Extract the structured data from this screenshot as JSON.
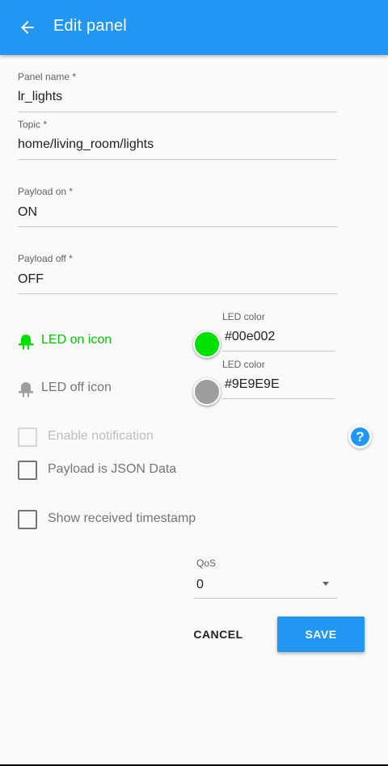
{
  "appbar": {
    "title": "Edit panel",
    "back_icon": "arrow-left-icon",
    "bg_color": "#2196f3"
  },
  "form": {
    "panel_name": {
      "label": "Panel name *",
      "value": "lr_lights"
    },
    "topic": {
      "label": "Topic *",
      "value": "home/living_room/lights"
    },
    "payload_on": {
      "label": "Payload on *",
      "value": "ON"
    },
    "payload_off": {
      "label": "Payload off *",
      "value": "OFF"
    },
    "led_on": {
      "label": "LED on icon",
      "icon": "led-bulb-icon",
      "color_label": "LED color",
      "color_value": "#00e002",
      "color": "#00e002"
    },
    "led_off": {
      "label": "LED off icon",
      "icon": "led-bulb-icon",
      "color_label": "LED color",
      "color_value": "#9E9E9E",
      "color": "#9E9E9E"
    },
    "enable_notification": {
      "label": "Enable notification",
      "checked": false,
      "disabled": true
    },
    "help_icon": "help-circle-icon",
    "payload_json": {
      "label": "Payload is JSON Data",
      "checked": false
    },
    "show_timestamp": {
      "label": "Show received timestamp",
      "checked": false
    },
    "qos": {
      "label": "QoS",
      "value": "0"
    }
  },
  "actions": {
    "cancel": "CANCEL",
    "save": "SAVE"
  }
}
